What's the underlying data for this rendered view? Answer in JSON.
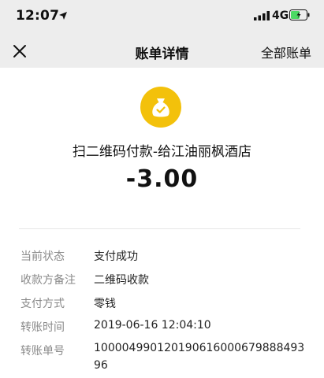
{
  "status_bar": {
    "time": "12:07",
    "network": "4G"
  },
  "nav": {
    "title": "账单详情",
    "right_link": "全部账单"
  },
  "transaction": {
    "merchant": "扫二维码付款-给江油丽枫酒店",
    "amount": "-3.00"
  },
  "details": {
    "status_label": "当前状态",
    "status_value": "支付成功",
    "note_label": "收款方备注",
    "note_value": "二维码收款",
    "method_label": "支付方式",
    "method_value": "零钱",
    "time_label": "转账时间",
    "time_value": "2019-06-16 12:04:10",
    "id_label": "转账单号",
    "id_value": "100004990120190616000679888493 96"
  },
  "colors": {
    "accent": "#f3c10b",
    "header_bg": "#ededed",
    "battery": "#4cd964"
  }
}
